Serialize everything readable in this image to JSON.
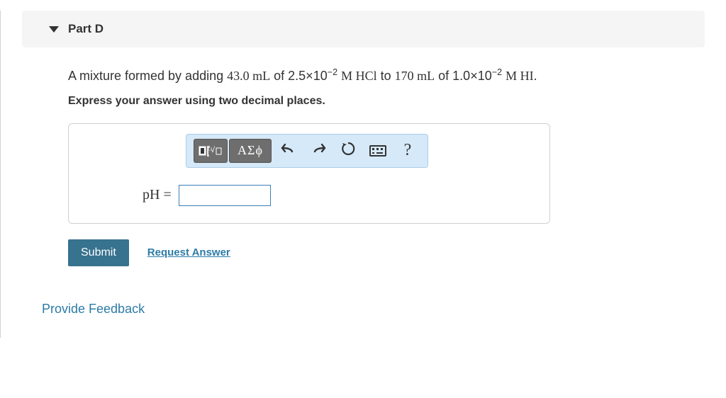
{
  "part": {
    "label": "Part D"
  },
  "question": {
    "prefix": "A mixture formed by adding ",
    "vol1": "43.0 mL",
    "conc1_base": "2.5×10",
    "conc1_exp": "−2",
    "unit1": " M HCl",
    "mid": " to ",
    "vol2": "170 mL",
    "conc2_base": "1.0×10",
    "conc2_exp": "−2",
    "unit2": " M HI",
    "suffix": "."
  },
  "instruction": "Express your answer using two decimal places.",
  "toolbar": {
    "greek_label": "ΑΣϕ",
    "help_label": "?"
  },
  "answer": {
    "variable": "pH",
    "equals": "=",
    "value": ""
  },
  "actions": {
    "submit": "Submit",
    "request": "Request Answer"
  },
  "feedback": "Provide Feedback"
}
